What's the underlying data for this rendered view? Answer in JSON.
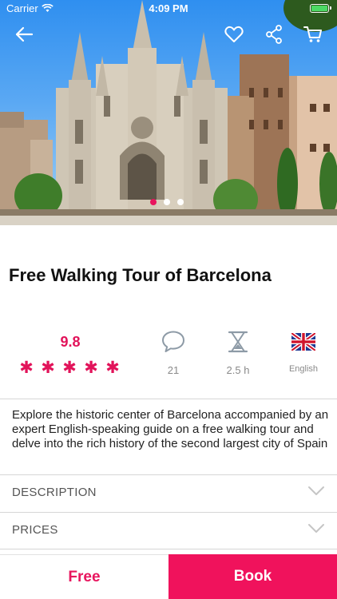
{
  "status_bar": {
    "carrier": "Carrier",
    "time": "4:09 PM",
    "battery_color": "#4cd964"
  },
  "nav": {
    "icons": [
      "back-arrow-icon",
      "heart-icon",
      "share-icon",
      "cart-icon"
    ]
  },
  "carousel": {
    "page_count": 3,
    "active_index": 0,
    "active_color": "#e8155e"
  },
  "tour": {
    "title": "Free Walking Tour of Barcelona",
    "rating": "9.8",
    "stars": 5,
    "comments": "21",
    "duration": "2.5 h",
    "language": "English",
    "description": "Explore the historic center of Barcelona accompanied by an expert English-speaking guide on a free walking tour and delve into the rich history of the second largest city of Spain"
  },
  "sections": [
    {
      "label": "DESCRIPTION",
      "icon": "chevron-down-icon"
    },
    {
      "label": "PRICES",
      "icon": "chevron-down-icon"
    }
  ],
  "actions": {
    "free_label": "Free",
    "book_label": "Book",
    "accent_color": "#f0125c"
  }
}
